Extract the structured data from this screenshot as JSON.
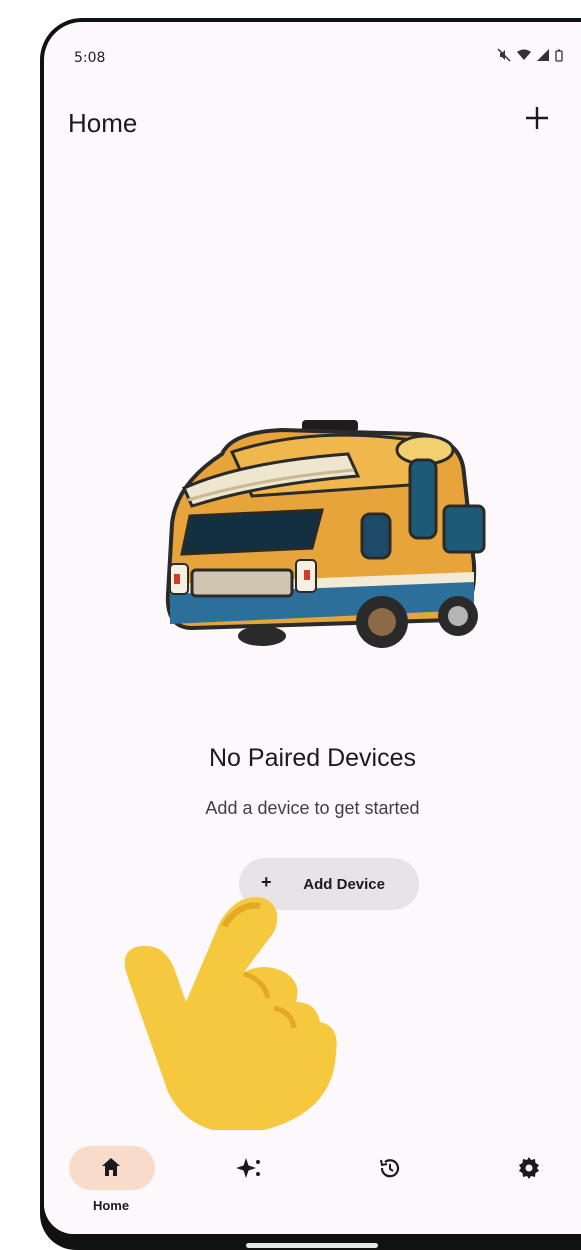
{
  "status_bar": {
    "time": "5:08",
    "icons": [
      "mute-icon",
      "wifi-icon",
      "signal-icon",
      "battery-icon"
    ]
  },
  "app_bar": {
    "title": "Home",
    "action_icon": "plus-icon"
  },
  "empty_state": {
    "title": "No Paired Devices",
    "subtitle": "Add a device to get started",
    "button_label": "Add Device",
    "button_icon": "plus-icon"
  },
  "bottom_nav": {
    "items": [
      {
        "label": "Home",
        "icon": "home-icon",
        "selected": true
      },
      {
        "label": "",
        "icon": "sparkle-icon",
        "selected": false
      },
      {
        "label": "",
        "icon": "history-icon",
        "selected": false
      },
      {
        "label": "",
        "icon": "gear-icon",
        "selected": false
      }
    ]
  },
  "colors": {
    "background": "#fcf8fb",
    "nav_selected": "#f8dcc9",
    "button": "#e7e4e8",
    "text": "#1b1b1f"
  }
}
